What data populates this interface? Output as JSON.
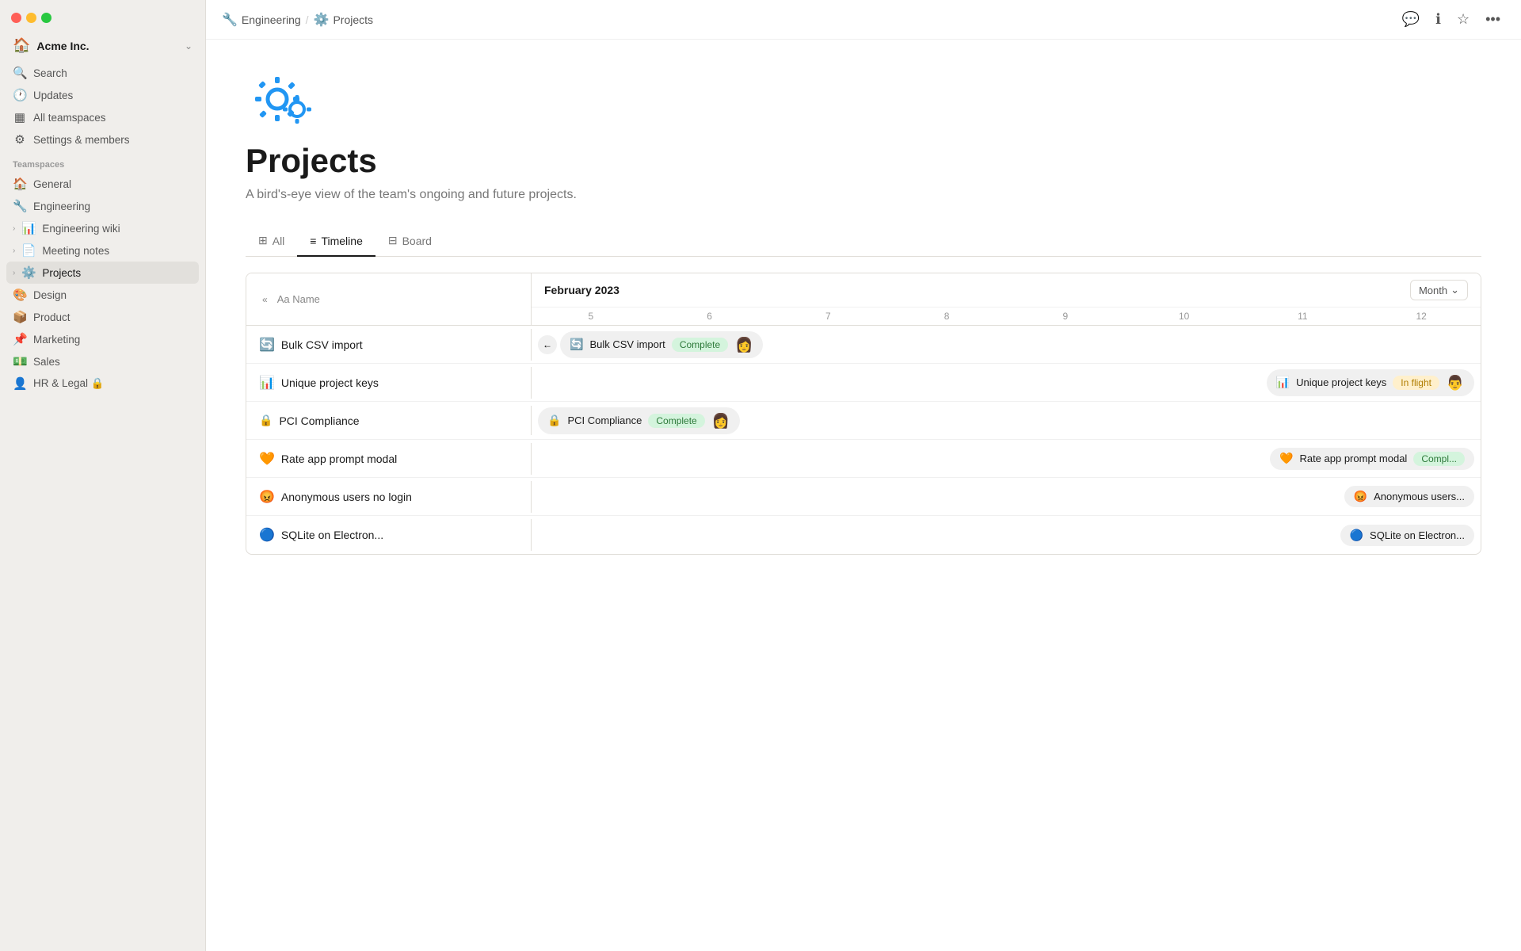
{
  "window": {
    "title": "Projects"
  },
  "sidebar": {
    "workspace": {
      "name": "Acme Inc.",
      "icon": "🏠"
    },
    "nav_items": [
      {
        "id": "search",
        "icon": "🔍",
        "label": "Search",
        "type": "action"
      },
      {
        "id": "updates",
        "icon": "🕐",
        "label": "Updates",
        "type": "action"
      },
      {
        "id": "all-teamspaces",
        "icon": "⊞",
        "label": "All teamspaces",
        "type": "action"
      },
      {
        "id": "settings",
        "icon": "⚙️",
        "label": "Settings & members",
        "type": "action"
      }
    ],
    "section_label": "Teamspaces",
    "teamspace_items": [
      {
        "id": "general",
        "icon": "🏠",
        "label": "General"
      },
      {
        "id": "engineering",
        "icon": "🔧",
        "label": "Engineering"
      },
      {
        "id": "engineering-wiki",
        "icon": "📊",
        "label": "Engineering wiki",
        "indented": false,
        "chevron": true
      },
      {
        "id": "meeting-notes",
        "icon": "📄",
        "label": "Meeting notes",
        "chevron": true
      },
      {
        "id": "projects",
        "icon": "⚙️",
        "label": "Projects",
        "active": true,
        "chevron": true
      },
      {
        "id": "design",
        "icon": "🎨",
        "label": "Design"
      },
      {
        "id": "product",
        "icon": "📦",
        "label": "Product"
      },
      {
        "id": "marketing",
        "icon": "📌",
        "label": "Marketing"
      },
      {
        "id": "sales",
        "icon": "💵",
        "label": "Sales"
      },
      {
        "id": "hr-legal",
        "icon": "👤",
        "label": "HR & Legal 🔒"
      }
    ]
  },
  "topbar": {
    "breadcrumb": [
      {
        "id": "engineering",
        "icon": "🔧",
        "label": "Engineering"
      },
      {
        "id": "projects",
        "icon": "⚙️",
        "label": "Projects"
      }
    ],
    "actions": [
      {
        "id": "comment",
        "icon": "💬"
      },
      {
        "id": "info",
        "icon": "ℹ️"
      },
      {
        "id": "star",
        "icon": "☆"
      },
      {
        "id": "more",
        "icon": "•••"
      }
    ]
  },
  "page": {
    "emoji": "⚙️",
    "title": "Projects",
    "subtitle": "A bird's-eye view of the team's ongoing and future projects."
  },
  "tabs": [
    {
      "id": "all",
      "icon": "⊞",
      "label": "All"
    },
    {
      "id": "timeline",
      "icon": "≡",
      "label": "Timeline",
      "active": true
    },
    {
      "id": "board",
      "icon": "⊟",
      "label": "Board"
    }
  ],
  "timeline": {
    "month": "February 2023",
    "month_selector_label": "Month",
    "days": [
      "5",
      "6",
      "7",
      "8",
      "9",
      "10",
      "11",
      "12"
    ],
    "col_name_label": "Aa  Name",
    "rows": [
      {
        "id": "bulk-csv",
        "icon": "🔄",
        "label": "Bulk CSV import",
        "bar": {
          "icon": "🔄",
          "label": "Bulk CSV import",
          "status": "Complete",
          "status_type": "complete",
          "avatar": "👩"
        }
      },
      {
        "id": "unique-keys",
        "icon": "📊",
        "label": "Unique project keys",
        "bar": {
          "icon": "📊",
          "label": "Unique project keys",
          "status": "In flight",
          "status_type": "inflight",
          "avatar": "👨"
        }
      },
      {
        "id": "pci",
        "icon": "🔒",
        "label": "PCI Compliance",
        "bar": {
          "icon": "🔒",
          "label": "PCI Compliance",
          "status": "Complete",
          "status_type": "complete",
          "avatar": "👩"
        }
      },
      {
        "id": "rate-app",
        "icon": "🧡",
        "label": "Rate app prompt modal",
        "bar": {
          "icon": "🧡",
          "label": "Rate app prompt modal",
          "status": "Compl...",
          "status_type": "complete",
          "avatar": ""
        }
      },
      {
        "id": "anonymous",
        "icon": "😡",
        "label": "Anonymous users no login",
        "bar": {
          "icon": "😡",
          "label": "Anonymous users...",
          "status": "",
          "status_type": "",
          "avatar": ""
        }
      },
      {
        "id": "sqlite",
        "icon": "🔵",
        "label": "SQLite on Electron...",
        "bar": {
          "icon": "🔵",
          "label": "SQLite on Electron...",
          "status": "",
          "status_type": "",
          "avatar": ""
        }
      }
    ]
  }
}
